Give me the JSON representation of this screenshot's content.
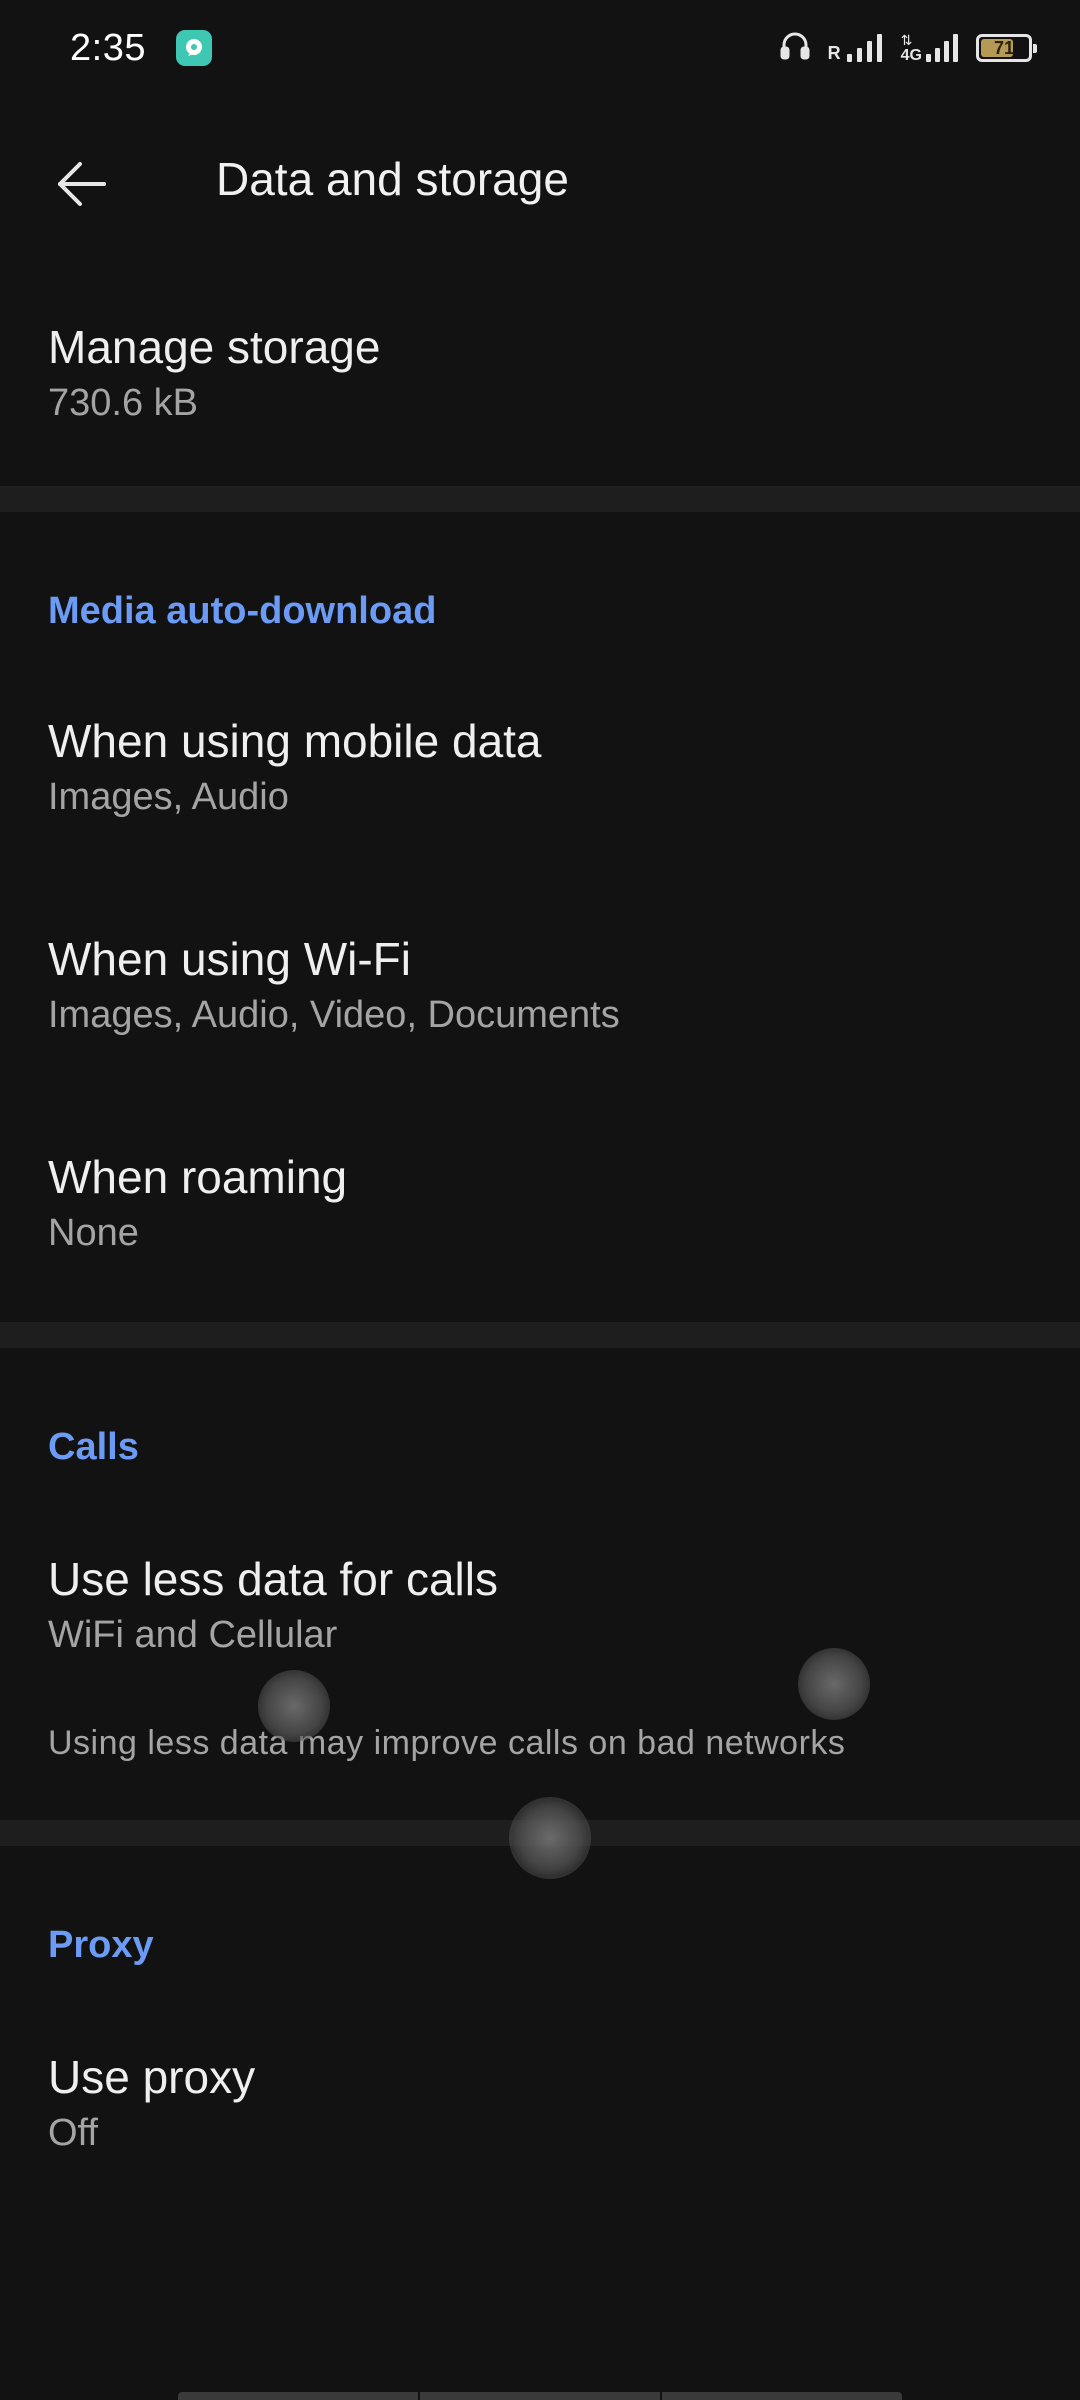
{
  "status_bar": {
    "time": "2:35",
    "app_icon": "chat-bubble-icon",
    "roaming_indicator": "R",
    "network_type": "4G",
    "battery_level": "71",
    "battery_fraction": 0.71,
    "battery_color": "#b59a55"
  },
  "header": {
    "title": "Data and storage",
    "back_icon": "arrow-left-icon"
  },
  "storage": {
    "title": "Manage storage",
    "value": "730.6 kB"
  },
  "media_auto_download": {
    "header": "Media auto-download",
    "items": [
      {
        "title": "When using mobile data",
        "value": "Images, Audio"
      },
      {
        "title": "When using Wi-Fi",
        "value": "Images, Audio, Video, Documents"
      },
      {
        "title": "When roaming",
        "value": "None"
      }
    ]
  },
  "calls": {
    "header": "Calls",
    "item": {
      "title": "Use less data for calls",
      "value": "WiFi and Cellular"
    },
    "note": "Using less data may improve calls on bad networks"
  },
  "proxy": {
    "header": "Proxy",
    "item": {
      "title": "Use proxy",
      "value": "Off"
    }
  },
  "colors": {
    "background": "#121212",
    "divider": "#1e1e1e",
    "accent": "#6b9bf5",
    "primary_text": "#efefef",
    "secondary_text": "#a4a4a4"
  }
}
